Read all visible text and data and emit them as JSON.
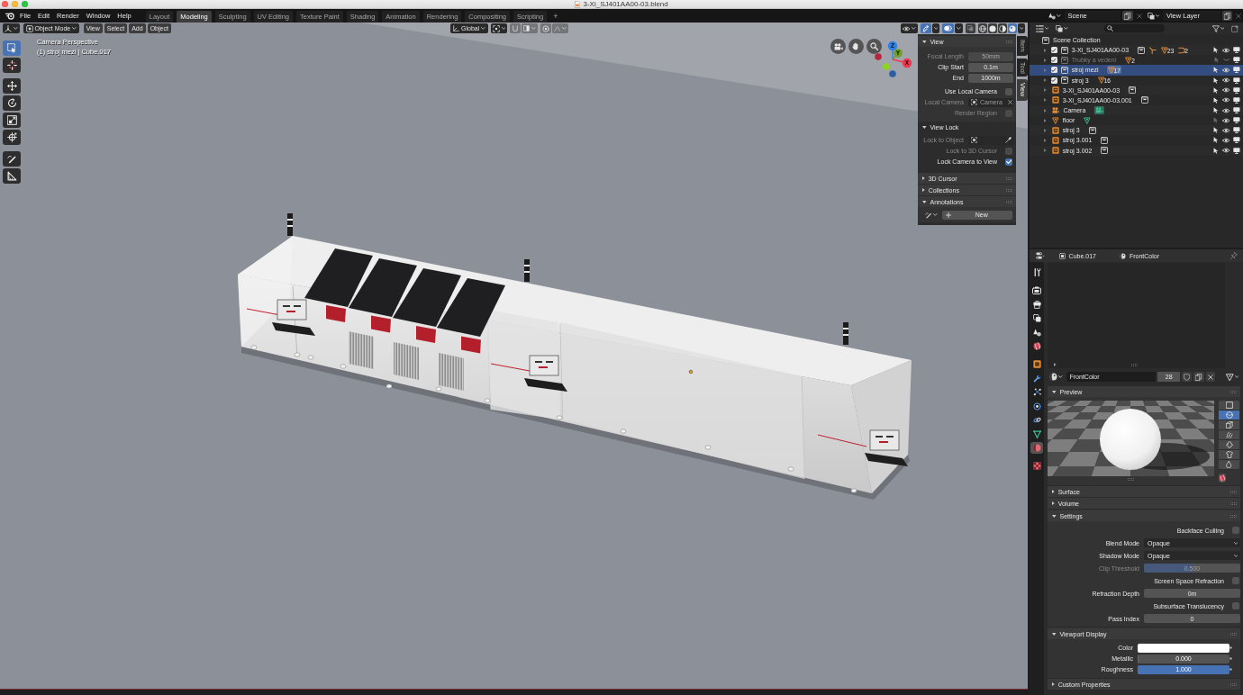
{
  "window": {
    "title": "3-Xi_SJ401AA00-03.blend"
  },
  "menu": [
    "File",
    "Edit",
    "Render",
    "Window",
    "Help"
  ],
  "workspaces": [
    {
      "label": "Layout",
      "selected": false
    },
    {
      "label": "Modeling",
      "selected": true
    },
    {
      "label": "Sculpting",
      "selected": false
    },
    {
      "label": "UV Editing",
      "selected": false
    },
    {
      "label": "Texture Paint",
      "selected": false
    },
    {
      "label": "Shading",
      "selected": false
    },
    {
      "label": "Animation",
      "selected": false
    },
    {
      "label": "Rendering",
      "selected": false
    },
    {
      "label": "Compositing",
      "selected": false
    },
    {
      "label": "Scripting",
      "selected": false
    }
  ],
  "add_workspace": "+",
  "scene": "Scene",
  "view_layer": "View Layer",
  "viewport": {
    "mode": "Object Mode",
    "menus": [
      "View",
      "Select",
      "Add",
      "Object"
    ],
    "orientation": "Global",
    "snapping": false,
    "proportional_editing": false,
    "gizmos": true,
    "overlays": true,
    "xray": false,
    "shading": [
      {
        "kind": "wireframe",
        "selected": false
      },
      {
        "kind": "solid",
        "selected": false
      },
      {
        "kind": "material",
        "selected": false
      },
      {
        "kind": "rendered",
        "selected": true
      }
    ],
    "info": [
      "Camera Perspective",
      "(1) stroj mezi | Cube.017"
    ],
    "tools": [
      {
        "kind": "select",
        "selected": true
      },
      {
        "kind": "cursor",
        "selected": false
      },
      {
        "kind": "move",
        "selected": false
      },
      {
        "kind": "rotate",
        "selected": false
      },
      {
        "kind": "scale",
        "selected": false
      },
      {
        "kind": "transform",
        "selected": false
      },
      {
        "kind": "annotate",
        "selected": false
      },
      {
        "kind": "measure",
        "selected": false
      }
    ],
    "axes": [
      {
        "kind": "positive",
        "label": "Z",
        "color": "#2e7fe8"
      },
      {
        "kind": "positive",
        "label": "Y",
        "color": "#6b9e23"
      },
      {
        "kind": "positive",
        "label": "X",
        "color": "#f0364f"
      },
      {
        "kind": "negative",
        "color": "#b3283c"
      },
      {
        "kind": "negative",
        "color": "#8ed31f"
      },
      {
        "kind": "negative",
        "color": "#2a5fa8"
      }
    ],
    "sidebar": {
      "tabs": [
        {
          "label": "Item",
          "selected": false
        },
        {
          "label": "Tool",
          "selected": false
        },
        {
          "label": "View",
          "selected": true
        }
      ],
      "panels": [
        {
          "title": "View",
          "expanded": true,
          "rows": [
            {
              "kind": "number",
              "label": "Focal Length",
              "value": "50mm",
              "disabled": true
            },
            {
              "kind": "number",
              "label": "Clip Start",
              "value": "0.1m",
              "disabled": false
            },
            {
              "kind": "number",
              "label": "End",
              "value": "1000m",
              "disabled": false
            },
            {
              "kind": "checkbox",
              "label": "Use Local Camera",
              "checked": false,
              "disabled": false
            },
            {
              "kind": "object",
              "label": "Local Camera",
              "value": "Camera",
              "disabled": true
            },
            {
              "kind": "checkbox",
              "label": "Render Region",
              "checked": false,
              "disabled": true
            }
          ],
          "subpanels": [
            {
              "title": "View Lock",
              "expanded": true,
              "rows": [
                {
                  "kind": "object",
                  "label": "Lock to Object",
                  "disabled": true
                },
                {
                  "kind": "checkbox",
                  "label": "Lock to 3D Cursor",
                  "checked": false,
                  "disabled": true
                },
                {
                  "kind": "checkbox",
                  "label": "Lock Camera to View",
                  "checked": true,
                  "disabled": false
                }
              ]
            }
          ]
        },
        {
          "title": "3D Cursor",
          "expanded": false
        },
        {
          "title": "Collections",
          "expanded": false
        },
        {
          "title": "Annotations",
          "expanded": true,
          "rows": [
            {
              "kind": "new",
              "value": "New"
            }
          ]
        }
      ]
    }
  },
  "outliner": {
    "root": "Scene Collection",
    "collections": [
      {
        "name": "3-Xi_SJ401AA00-03",
        "checked": true,
        "selected": false,
        "selectable": true,
        "visible": true,
        "contents": [
          {
            "kind": "collection"
          },
          {
            "kind": "empty"
          },
          {
            "kind": "mesh",
            "count": "23"
          },
          {
            "kind": "curve",
            "count": "2"
          }
        ]
      },
      {
        "name": "Trubky a vedeni",
        "checked": true,
        "selected": false,
        "selectable": false,
        "visible": false,
        "contents": [
          {
            "kind": "mesh",
            "count": "2"
          }
        ]
      },
      {
        "name": "stroj mezi",
        "checked": true,
        "selected": true,
        "selectable": true,
        "visible": true,
        "contents": [
          {
            "kind": "mesh",
            "count": "17"
          }
        ]
      },
      {
        "name": "stroj 3",
        "checked": true,
        "selected": false,
        "selectable": true,
        "visible": true,
        "contents": [
          {
            "kind": "mesh",
            "count": "16"
          }
        ]
      }
    ],
    "objects": [
      {
        "kind": "instance",
        "name": "3-Xi_SJ401AA00-03",
        "selected": false,
        "selectable": true,
        "visible": true,
        "contents": [
          {
            "kind": "collection"
          }
        ]
      },
      {
        "kind": "instance",
        "name": "3-Xi_SJ401AA00-03.001",
        "selected": false,
        "selectable": true,
        "visible": true,
        "contents": [
          {
            "kind": "collection"
          }
        ]
      },
      {
        "kind": "camera",
        "name": "Camera",
        "selected": false,
        "selectable": true,
        "visible": true,
        "contents": [
          {
            "kind": "camera_data"
          }
        ]
      },
      {
        "kind": "mesh",
        "name": "floor",
        "selected": false,
        "selectable": false,
        "visible": true,
        "contents": [
          {
            "kind": "mesh_data"
          }
        ]
      },
      {
        "kind": "instance",
        "name": "stroj 3",
        "selected": false,
        "selectable": true,
        "visible": true,
        "contents": [
          {
            "kind": "collection"
          }
        ]
      },
      {
        "kind": "instance",
        "name": "stroj 3.001",
        "selected": false,
        "selectable": true,
        "visible": true,
        "contents": [
          {
            "kind": "collection"
          }
        ]
      },
      {
        "kind": "instance",
        "name": "stroj 3.002",
        "selected": false,
        "selectable": true,
        "visible": true,
        "contents": [
          {
            "kind": "collection"
          }
        ]
      }
    ]
  },
  "properties": {
    "object": "Cube.017",
    "material": "FrontColor",
    "tabs": [
      {
        "kind": "tool",
        "selected": false
      },
      {
        "kind": "render",
        "selected": false
      },
      {
        "kind": "output",
        "selected": false
      },
      {
        "kind": "view_layer",
        "selected": false
      },
      {
        "kind": "scene",
        "selected": false
      },
      {
        "kind": "world",
        "selected": false
      },
      {
        "kind": "object",
        "selected": false
      },
      {
        "kind": "modifiers",
        "selected": false
      },
      {
        "kind": "particles",
        "selected": false
      },
      {
        "kind": "physics",
        "selected": false
      },
      {
        "kind": "constraints",
        "selected": false
      },
      {
        "kind": "data",
        "selected": false
      },
      {
        "kind": "material",
        "selected": true
      },
      {
        "kind": "texture",
        "selected": false
      }
    ],
    "datablock": {
      "name": "FrontColor",
      "users": "28"
    },
    "panels": [
      {
        "kind": "preview",
        "title": "Preview",
        "expanded": true,
        "shapes": [
          {
            "kind": "flat",
            "selected": false
          },
          {
            "kind": "sphere",
            "selected": true
          },
          {
            "kind": "cube",
            "selected": false
          },
          {
            "kind": "hair",
            "selected": false
          },
          {
            "kind": "monkey",
            "selected": false
          },
          {
            "kind": "cloth",
            "selected": false
          },
          {
            "kind": "fluid",
            "selected": false
          }
        ]
      },
      {
        "kind": "fields",
        "title": "Surface",
        "expanded": false
      },
      {
        "kind": "fields",
        "title": "Volume",
        "expanded": false
      },
      {
        "kind": "fields",
        "title": "Settings",
        "expanded": true,
        "decorators": false,
        "rows": [
          {
            "kind": "checkbox",
            "label": "Backface Culling",
            "checked": false,
            "disabled": false
          },
          {
            "kind": "dropdown",
            "label": "Blend Mode",
            "value": "Opaque",
            "disabled": false
          },
          {
            "kind": "dropdown",
            "label": "Shadow Mode",
            "value": "Opaque",
            "disabled": false
          },
          {
            "kind": "slider",
            "label": "Clip Threshold",
            "value": "0.500",
            "level": 0.5,
            "disabled": true
          },
          {
            "kind": "checkbox",
            "label": "Screen Space Refraction",
            "checked": false,
            "disabled": false
          },
          {
            "kind": "number",
            "label": "Refraction Depth",
            "value": "0m",
            "disabled": false
          },
          {
            "kind": "checkbox",
            "label": "Subsurface Translucency",
            "checked": false,
            "disabled": false
          },
          {
            "kind": "number",
            "label": "Pass Index",
            "value": "0",
            "disabled": false
          }
        ]
      },
      {
        "kind": "fields",
        "title": "Viewport Display",
        "expanded": true,
        "decorators": true,
        "rows": [
          {
            "kind": "color",
            "label": "Color",
            "color": "#ffffff",
            "disabled": false
          },
          {
            "kind": "slider",
            "label": "Metallic",
            "value": "0.000",
            "level": 0,
            "disabled": false
          },
          {
            "kind": "slider",
            "label": "Roughness",
            "value": "1.000",
            "level": 1,
            "disabled": false
          }
        ]
      },
      {
        "kind": "fields",
        "title": "Custom Properties",
        "expanded": false
      }
    ]
  }
}
